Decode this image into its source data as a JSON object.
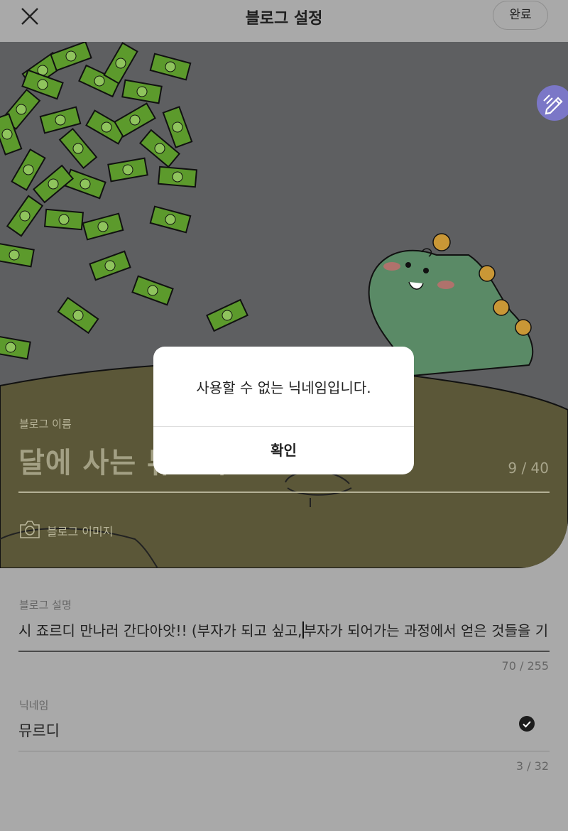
{
  "header": {
    "title": "블로그 설정",
    "done_label": "완료",
    "close_icon": "close-icon"
  },
  "cover": {
    "edit_icon": "pencil-icon",
    "blog_name_label": "블로그 이름",
    "blog_name_value": "달에 사는 뮤르디",
    "blog_name_count": "9 / 40",
    "blog_image_icon": "camera-icon",
    "blog_image_label": "블로그 이미지"
  },
  "description": {
    "label": "블로그 설명",
    "text_before_caret": "시 죠르디 만나러 간다아앗!!  (부자가 되고 싶고,",
    "text_after_caret": "부자가 되어가는 과정에서 얻은 것들을 기",
    "count": "70 / 255"
  },
  "nickname": {
    "label": "닉네임",
    "value": "뮤르디",
    "count": "3 / 32",
    "status_icon": "check-circle-icon"
  },
  "dialog": {
    "message": "사용할 수 없는 닉네임입니다.",
    "confirm_label": "확인"
  },
  "colors": {
    "dim_overlay": "#a9a9a9",
    "cover_sky": "#5e5f61",
    "cover_ground": "#5b5738",
    "edit_button": "#7b77c7",
    "dialog_bg": "#ffffff"
  }
}
